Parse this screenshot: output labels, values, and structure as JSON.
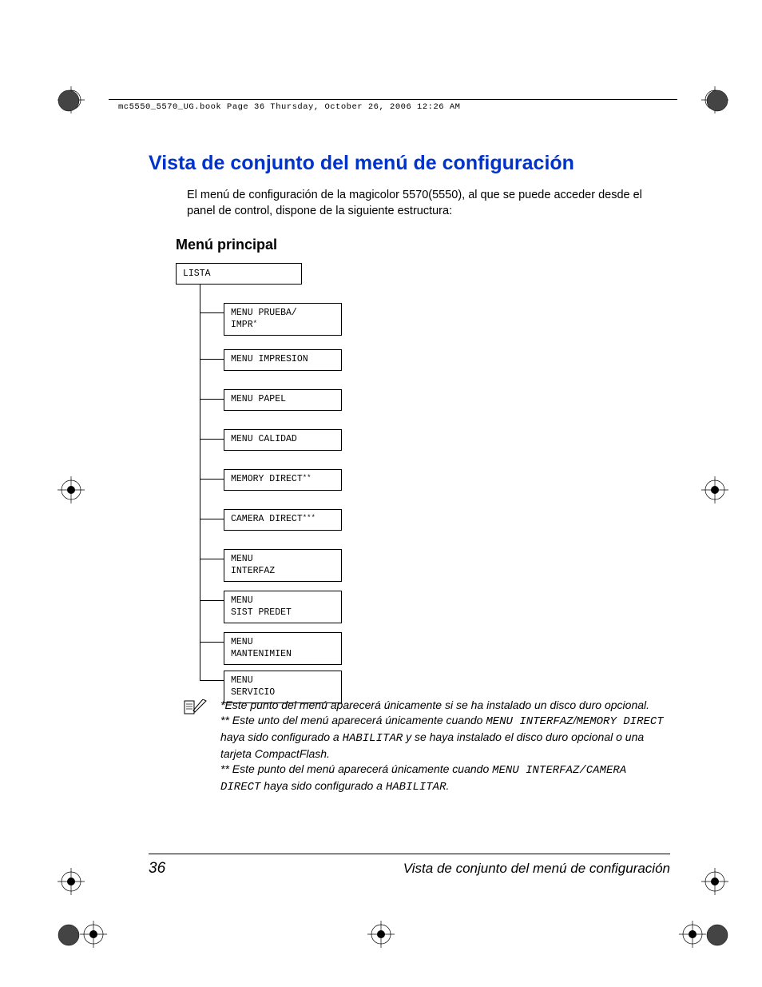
{
  "header_text": "mc5550_5570_UG.book  Page 36  Thursday, October 26, 2006  12:26 AM",
  "title": "Vista de conjunto del menú de configuración",
  "intro": "El menú de configuración de la magicolor 5570(5550), al que se puede acceder desde el panel de control, dispone de la siguiente estructura:",
  "subtitle": "Menú principal",
  "root_label": "LISTA",
  "menu_items": [
    {
      "label": "MENU PRUEBA/\nIMPR",
      "suffix": "*"
    },
    {
      "label": "MENU IMPRESION",
      "suffix": ""
    },
    {
      "label": "MENU PAPEL",
      "suffix": ""
    },
    {
      "label": "MENU CALIDAD",
      "suffix": ""
    },
    {
      "label": "MEMORY DIRECT",
      "suffix": "**"
    },
    {
      "label": "CAMERA DIRECT",
      "suffix": "***"
    },
    {
      "label": "MENU\nINTERFAZ",
      "suffix": ""
    },
    {
      "label": "MENU\nSIST PREDET",
      "suffix": ""
    },
    {
      "label": "MENU\nMANTENIMIEN",
      "suffix": ""
    },
    {
      "label": "MENU\nSERVICIO",
      "suffix": ""
    }
  ],
  "notes": {
    "n1a": "*Este punto del menú aparecerá únicamente si se ha instalado un disco duro opcional.",
    "n2a": "** Este unto del menú aparecerá únicamente cuando ",
    "n2b": "MENU INTERFAZ",
    "n2c": "/",
    "n2d": "MEMORY DIRECT",
    "n2e": " haya sido configurado a ",
    "n2f": "HABILITAR",
    "n2g": " y se haya instalado el disco duro opcional o una tarjeta CompactFlash.",
    "n3a": "** Este punto del menú aparecerá únicamente cuando ",
    "n3b": "MENU INTERFAZ/CAMERA DIRECT",
    "n3c": " haya sido configurado a ",
    "n3d": "HABILITAR",
    "n3e": "."
  },
  "footer_page": "36",
  "footer_title": "Vista de conjunto del menú de configuración"
}
